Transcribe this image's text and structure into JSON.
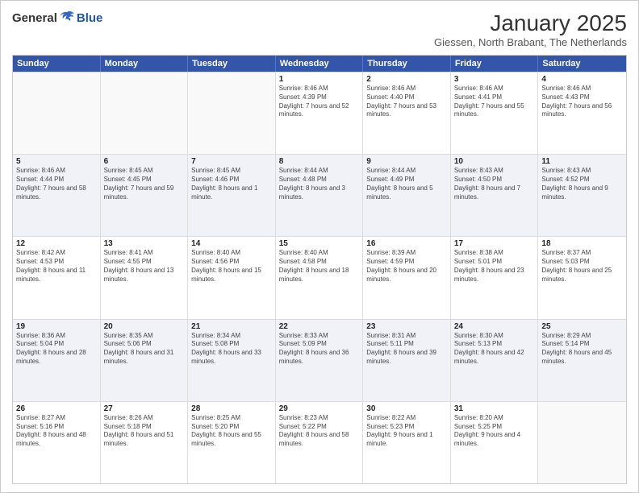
{
  "logo": {
    "general": "General",
    "blue": "Blue"
  },
  "header": {
    "month": "January 2025",
    "location": "Giessen, North Brabant, The Netherlands"
  },
  "days": [
    "Sunday",
    "Monday",
    "Tuesday",
    "Wednesday",
    "Thursday",
    "Friday",
    "Saturday"
  ],
  "rows": [
    [
      {
        "day": "",
        "text": "",
        "empty": true
      },
      {
        "day": "",
        "text": "",
        "empty": true
      },
      {
        "day": "",
        "text": "",
        "empty": true
      },
      {
        "day": "1",
        "text": "Sunrise: 8:46 AM\nSunset: 4:39 PM\nDaylight: 7 hours and 52 minutes."
      },
      {
        "day": "2",
        "text": "Sunrise: 8:46 AM\nSunset: 4:40 PM\nDaylight: 7 hours and 53 minutes."
      },
      {
        "day": "3",
        "text": "Sunrise: 8:46 AM\nSunset: 4:41 PM\nDaylight: 7 hours and 55 minutes."
      },
      {
        "day": "4",
        "text": "Sunrise: 8:46 AM\nSunset: 4:43 PM\nDaylight: 7 hours and 56 minutes."
      }
    ],
    [
      {
        "day": "5",
        "text": "Sunrise: 8:46 AM\nSunset: 4:44 PM\nDaylight: 7 hours and 58 minutes."
      },
      {
        "day": "6",
        "text": "Sunrise: 8:45 AM\nSunset: 4:45 PM\nDaylight: 7 hours and 59 minutes."
      },
      {
        "day": "7",
        "text": "Sunrise: 8:45 AM\nSunset: 4:46 PM\nDaylight: 8 hours and 1 minute."
      },
      {
        "day": "8",
        "text": "Sunrise: 8:44 AM\nSunset: 4:48 PM\nDaylight: 8 hours and 3 minutes."
      },
      {
        "day": "9",
        "text": "Sunrise: 8:44 AM\nSunset: 4:49 PM\nDaylight: 8 hours and 5 minutes."
      },
      {
        "day": "10",
        "text": "Sunrise: 8:43 AM\nSunset: 4:50 PM\nDaylight: 8 hours and 7 minutes."
      },
      {
        "day": "11",
        "text": "Sunrise: 8:43 AM\nSunset: 4:52 PM\nDaylight: 8 hours and 9 minutes."
      }
    ],
    [
      {
        "day": "12",
        "text": "Sunrise: 8:42 AM\nSunset: 4:53 PM\nDaylight: 8 hours and 11 minutes."
      },
      {
        "day": "13",
        "text": "Sunrise: 8:41 AM\nSunset: 4:55 PM\nDaylight: 8 hours and 13 minutes."
      },
      {
        "day": "14",
        "text": "Sunrise: 8:40 AM\nSunset: 4:56 PM\nDaylight: 8 hours and 15 minutes."
      },
      {
        "day": "15",
        "text": "Sunrise: 8:40 AM\nSunset: 4:58 PM\nDaylight: 8 hours and 18 minutes."
      },
      {
        "day": "16",
        "text": "Sunrise: 8:39 AM\nSunset: 4:59 PM\nDaylight: 8 hours and 20 minutes."
      },
      {
        "day": "17",
        "text": "Sunrise: 8:38 AM\nSunset: 5:01 PM\nDaylight: 8 hours and 23 minutes."
      },
      {
        "day": "18",
        "text": "Sunrise: 8:37 AM\nSunset: 5:03 PM\nDaylight: 8 hours and 25 minutes."
      }
    ],
    [
      {
        "day": "19",
        "text": "Sunrise: 8:36 AM\nSunset: 5:04 PM\nDaylight: 8 hours and 28 minutes."
      },
      {
        "day": "20",
        "text": "Sunrise: 8:35 AM\nSunset: 5:06 PM\nDaylight: 8 hours and 31 minutes."
      },
      {
        "day": "21",
        "text": "Sunrise: 8:34 AM\nSunset: 5:08 PM\nDaylight: 8 hours and 33 minutes."
      },
      {
        "day": "22",
        "text": "Sunrise: 8:33 AM\nSunset: 5:09 PM\nDaylight: 8 hours and 36 minutes."
      },
      {
        "day": "23",
        "text": "Sunrise: 8:31 AM\nSunset: 5:11 PM\nDaylight: 8 hours and 39 minutes."
      },
      {
        "day": "24",
        "text": "Sunrise: 8:30 AM\nSunset: 5:13 PM\nDaylight: 8 hours and 42 minutes."
      },
      {
        "day": "25",
        "text": "Sunrise: 8:29 AM\nSunset: 5:14 PM\nDaylight: 8 hours and 45 minutes."
      }
    ],
    [
      {
        "day": "26",
        "text": "Sunrise: 8:27 AM\nSunset: 5:16 PM\nDaylight: 8 hours and 48 minutes."
      },
      {
        "day": "27",
        "text": "Sunrise: 8:26 AM\nSunset: 5:18 PM\nDaylight: 8 hours and 51 minutes."
      },
      {
        "day": "28",
        "text": "Sunrise: 8:25 AM\nSunset: 5:20 PM\nDaylight: 8 hours and 55 minutes."
      },
      {
        "day": "29",
        "text": "Sunrise: 8:23 AM\nSunset: 5:22 PM\nDaylight: 8 hours and 58 minutes."
      },
      {
        "day": "30",
        "text": "Sunrise: 8:22 AM\nSunset: 5:23 PM\nDaylight: 9 hours and 1 minute."
      },
      {
        "day": "31",
        "text": "Sunrise: 8:20 AM\nSunset: 5:25 PM\nDaylight: 9 hours and 4 minutes."
      },
      {
        "day": "",
        "text": "",
        "empty": true
      }
    ]
  ]
}
